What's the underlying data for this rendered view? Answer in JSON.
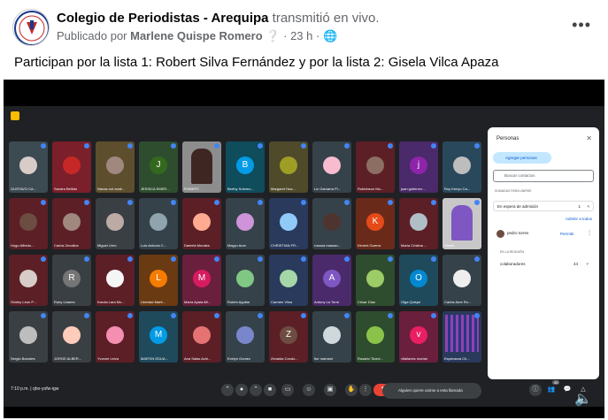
{
  "post": {
    "page_name": "Colegio de Periodistas - Arequipa",
    "action": "transmitió en vivo.",
    "published_by_prefix": "Publicado por",
    "author": "Marlene Quispe Romero",
    "time": "23 h",
    "message": "Participan por la lista 1: Robert Silva Fernández y por la lista 2: Gisela Vilca Apaza",
    "more_icon": "more-dots-icon",
    "privacy_icon": "globe-icon"
  },
  "meet": {
    "tiles": [
      {
        "name": "GUSTAVO CA...",
        "bg": "#3c4a52",
        "type": "photo",
        "color": "#d7ccc8"
      },
      {
        "name": "Sandra Bellido",
        "bg": "#7b1f2a",
        "type": "photo",
        "color": "#c62828"
      },
      {
        "name": "Nanas not avail...",
        "bg": "#5d4f2e",
        "type": "photo",
        "color": "#a1887f"
      },
      {
        "name": "JESSICA EMER...",
        "bg": "#2e4d2e",
        "type": "letter",
        "letter": "J",
        "color": "#33691e"
      },
      {
        "name": "ROBERT...",
        "bg": "#8d8d8d",
        "type": "video",
        "color": "#3e2723"
      },
      {
        "name": "Berthy Sotomo...",
        "bg": "#0f4c5c",
        "type": "letter",
        "letter": "B",
        "color": "#039be5"
      },
      {
        "name": "Margaret Hua...",
        "bg": "#4e4a2a",
        "type": "photo",
        "color": "#9e9d24"
      },
      {
        "name": "Liz Gamarra Pi...",
        "bg": "#35424a",
        "type": "photo",
        "color": "#f8bbd0"
      },
      {
        "name": "Robbinson Mo...",
        "bg": "#5c1f26",
        "type": "photo",
        "color": "#8d6e63"
      },
      {
        "name": "juan gutierrez...",
        "bg": "#4a2a6a",
        "type": "letter",
        "letter": "j",
        "color": "#8e24aa"
      },
      {
        "name": "Roy Kenyo Ca...",
        "bg": "#29485c",
        "type": "photo",
        "color": "#bdbdbd"
      },
      {
        "name": "Hugo Alfredo...",
        "bg": "#5c1f26",
        "type": "photo",
        "color": "#6d4c41"
      },
      {
        "name": "Carlos Zevallos",
        "bg": "#5c1f26",
        "type": "photo",
        "color": "#a1887f"
      },
      {
        "name": "Miguel Urrio",
        "bg": "#3a3f44",
        "type": "photo",
        "color": "#bcaaa4"
      },
      {
        "name": "Luis Antonio C...",
        "bg": "#35424a",
        "type": "photo",
        "color": "#90a4ae"
      },
      {
        "name": "Daniela Morales",
        "bg": "#5c1f26",
        "type": "photo",
        "color": "#ffab91"
      },
      {
        "name": "Mayyu Arce",
        "bg": "#35424a",
        "type": "photo",
        "color": "#ce93d8"
      },
      {
        "name": "CHRISTIAN FR...",
        "bg": "#2a3a5c",
        "type": "photo",
        "color": "#90caf9"
      },
      {
        "name": "rosana maman...",
        "bg": "#35424a",
        "type": "photo",
        "color": "#4e342e"
      },
      {
        "name": "Kirvent Guerra",
        "bg": "#6a2a1a",
        "type": "letter",
        "letter": "K",
        "color": "#e64a19"
      },
      {
        "name": "María Cristina ...",
        "bg": "#5c1f26",
        "type": "photo",
        "color": "#b0bec5"
      },
      {
        "name": "Gisela",
        "bg": "#c8c8c8",
        "type": "video",
        "color": "#7e57c2"
      },
      {
        "name": "Shirley Leon P...",
        "bg": "#5c1f26",
        "type": "photo",
        "color": "#d7ccc8"
      },
      {
        "name": "Ruby Linares",
        "bg": "#3a3f44",
        "type": "letter",
        "letter": "R",
        "color": "#757575"
      },
      {
        "name": "Karola Lara Mo...",
        "bg": "#5c1f26",
        "type": "photo",
        "color": "#f5f5f5"
      },
      {
        "name": "Libertad Marti...",
        "bg": "#6a3a12",
        "type": "letter",
        "letter": "L",
        "color": "#f57c00"
      },
      {
        "name": "María Ayala Alf...",
        "bg": "#6a1f3c",
        "type": "letter",
        "letter": "M",
        "color": "#d81b60"
      },
      {
        "name": "Rubén Aguilar",
        "bg": "#35424a",
        "type": "photo",
        "color": "#81c784"
      },
      {
        "name": "Carmen Vilca",
        "bg": "#2a3a5c",
        "type": "photo",
        "color": "#a5d6a7"
      },
      {
        "name": "Antony La Torre",
        "bg": "#4a2a6a",
        "type": "letter",
        "letter": "A",
        "color": "#7e57c2"
      },
      {
        "name": "César Díaz",
        "bg": "#2e4d2e",
        "type": "photo",
        "color": "#9ccc65"
      },
      {
        "name": "Olga Quispe",
        "bg": "#1f4a5c",
        "type": "letter",
        "letter": "O",
        "color": "#0288d1"
      },
      {
        "name": "Carlos Ame Ro...",
        "bg": "#35424a",
        "type": "photo",
        "color": "#eeeeee"
      },
      {
        "name": "Sergio Barrales",
        "bg": "#3a3f44",
        "type": "photo",
        "color": "#bdbdbd"
      },
      {
        "name": "JORGE ALBER...",
        "bg": "#3a3f44",
        "type": "photo",
        "color": "#ffccbc"
      },
      {
        "name": "Yvonne Leiva",
        "bg": "#5c1f26",
        "type": "photo",
        "color": "#f48fb1"
      },
      {
        "name": "MARTIN EDUA...",
        "bg": "#1f4a5c",
        "type": "letter",
        "letter": "M",
        "color": "#039be5"
      },
      {
        "name": "Ana Salas Achi...",
        "bg": "#5c1f26",
        "type": "photo",
        "color": "#e57373"
      },
      {
        "name": "Evelyn Gomez",
        "bg": "#35424a",
        "type": "photo",
        "color": "#7986cb"
      },
      {
        "name": "Zenaida Condo...",
        "bg": "#5c1f26",
        "type": "letter",
        "letter": "Z",
        "color": "#6d4c41"
      },
      {
        "name": "flor mamani",
        "bg": "#35424a",
        "type": "photo",
        "color": "#cfd8dc"
      },
      {
        "name": "Rosario Ticoni...",
        "bg": "#2e4d2e",
        "type": "photo",
        "color": "#8bc34a"
      },
      {
        "name": "vifallanes morian",
        "bg": "#6a1f3c",
        "type": "letter",
        "letter": "v",
        "color": "#e91e63"
      },
      {
        "name": "Esperanza Ch...",
        "bg": "#2a3a5c",
        "type": "grid",
        "color": "#ab47bc"
      }
    ],
    "panel": {
      "title": "Personas",
      "close_icon": "close-icon",
      "add_people": "Agregar personas",
      "search_placeholder": "Buscar contactos",
      "section_label": "SUMADAS PARA UNIRSE",
      "waiting_label": "En espera de admisión",
      "waiting_count": "1",
      "admit_all": "Admitir a todos",
      "waiting_person": "pedro torres",
      "admit_single": "Permitir",
      "in_meeting_label": "EN LA REUNIÓN",
      "collaborators_label": "colaboradores",
      "collaborators_count": "44"
    },
    "controls": {
      "time": "7:10 p.m.",
      "meeting_code": "qho-yofw-igw",
      "toast": "Alguien quiere unirse a esta llamada",
      "participant_badge": "45"
    }
  }
}
